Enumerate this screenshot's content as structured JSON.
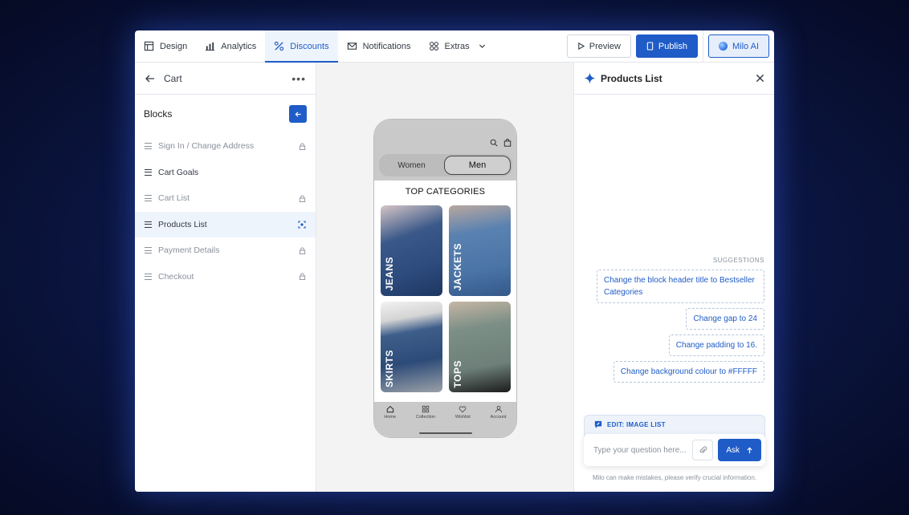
{
  "nav": {
    "tabs": [
      {
        "label": "Design",
        "icon": "layout-icon"
      },
      {
        "label": "Analytics",
        "icon": "bar-chart-icon"
      },
      {
        "label": "Discounts",
        "icon": "percent-icon",
        "active": true
      },
      {
        "label": "Notifications",
        "icon": "mail-icon"
      },
      {
        "label": "Extras",
        "icon": "grid-icon"
      }
    ],
    "preview_label": "Preview",
    "publish_label": "Publish",
    "ai_label": "Milo AI"
  },
  "left": {
    "title": "Cart",
    "blocks_title": "Blocks",
    "items": [
      {
        "label": "Sign In / Change Address",
        "state": "locked"
      },
      {
        "label": "Cart Goals",
        "state": "enabled"
      },
      {
        "label": "Cart List",
        "state": "locked"
      },
      {
        "label": "Products List",
        "state": "selected"
      },
      {
        "label": "Payment Details",
        "state": "locked"
      },
      {
        "label": "Checkout",
        "state": "locked"
      }
    ]
  },
  "phone": {
    "tab_women": "Women",
    "tab_men": "Men",
    "category_title": "TOP CATEGORIES",
    "tiles": [
      "JEANS",
      "JACKETS",
      "SKIRTS",
      "TOPS"
    ],
    "nav": [
      "Home",
      "Collection",
      "Wishlist",
      "Account"
    ]
  },
  "right": {
    "title": "Products List",
    "suggestions_label": "SUGGESTIONS",
    "suggestions": [
      "Change the block header title to Bestseller Categories",
      "Change gap to 24",
      "Change padding to 16.",
      "Change background colour to #FFFFF"
    ],
    "edit_title": "EDIT: IMAGE LIST",
    "input_placeholder": "Type your question here...",
    "ask_label": "Ask",
    "disclaimer": "Milo can make mistakes, please verify crucial information."
  },
  "colors": {
    "accent": "#1f5cc7",
    "selected_bg": "#eef4fc",
    "muted": "#8a919c"
  }
}
